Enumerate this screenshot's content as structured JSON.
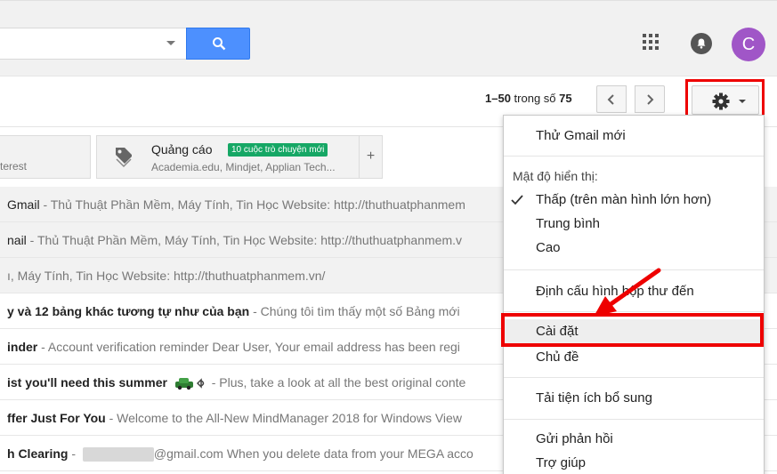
{
  "header": {
    "avatar_letter": "C",
    "accent_color": "#4d90fe",
    "avatar_color": "#a056c7"
  },
  "toolbar": {
    "page_range": "1–50",
    "page_of": "trong số",
    "page_total": "75"
  },
  "tabs": {
    "partial_label": "terest",
    "promo": {
      "title": "Quảng cáo",
      "badge": "10 cuộc trò chuyện mới",
      "senders": "Academia.edu, Mindjet, Applian Tech..."
    },
    "add_label": "+"
  },
  "emails": [
    {
      "subject": "Gmail",
      "snippet": " - Thủ Thuật Phần Mềm, Máy Tính, Tin Học Website: http://thuthuatphanmem",
      "unread": false
    },
    {
      "subject": "nail",
      "snippet": " - Thủ Thuật Phần Mềm, Máy Tính, Tin Học Website: http://thuthuatphanmem.v",
      "unread": false
    },
    {
      "subject": "",
      "snippet": "ı, Máy Tính, Tin Học Website: http://thuthuatphanmem.vn/",
      "unread": false
    },
    {
      "subject": "y và 12 bảng khác tương tự như của bạn",
      "snippet": " - Chúng tôi tìm thấy một số Bảng mới",
      "unread": true
    },
    {
      "subject": "inder",
      "snippet": " - Account verification reminder Dear User, Your email address has been regi",
      "unread": true
    },
    {
      "subject": "ist you'll need this summer",
      "snippet": " - Plus, take a look at all the best original conte",
      "unread": true
    },
    {
      "subject": "ffer Just For You",
      "snippet": " - Welcome to the All-New MindManager 2018 for Windows View",
      "unread": true
    },
    {
      "subject": "h Clearing",
      "snippet_prefix": " - ",
      "snippet": "@gmail.com When you delete data from your MEGA acco",
      "unread": true
    }
  ],
  "menu": {
    "try_new": "Thử Gmail mới",
    "density_label": "Mật độ hiển thị:",
    "density_low": "Thấp (trên màn hình lớn hơn)",
    "density_medium": "Trung bình",
    "density_high": "Cao",
    "configure_inbox": "Định cấu hình hộp thư đến",
    "settings": "Cài đặt",
    "themes": "Chủ đề",
    "addons": "Tải tiện ích bổ sung",
    "feedback": "Gửi phản hồi",
    "help": "Trợ giúp"
  },
  "annotation_color": "#e00000"
}
